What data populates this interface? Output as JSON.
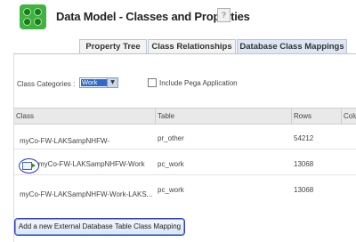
{
  "header": {
    "title": "Data Model - Classes and Properties",
    "help_label": "?"
  },
  "tabs": [
    {
      "label": "Property Tree"
    },
    {
      "label": "Class Relationships"
    },
    {
      "label": "Database Class Mappings",
      "active": true
    }
  ],
  "filters": {
    "class_categories_label": "Class Categories :",
    "selected": "Work",
    "include_pega_label": "Include Pega Application"
  },
  "table": {
    "columns": [
      "Class",
      "Table",
      "Rows",
      "Colu"
    ],
    "rows": [
      {
        "class": "myCo-FW-LAKSampNHFW-",
        "table": "pr_other",
        "rows": "54212"
      },
      {
        "class": "myCo-FW-LAKSampNHFW-Work",
        "table": "pc_work",
        "rows": "13068"
      },
      {
        "class": "myCo-FW-LAKSampNHFW-Work-LAKS...",
        "table": "pc_work",
        "rows": "13068"
      }
    ]
  },
  "actions": {
    "add_mapping_label": "Add a new External Database Table Class Mapping"
  },
  "colors": {
    "accent": "#2f3fb3",
    "logo": "#3fb33f",
    "selection": "#316ac5"
  }
}
